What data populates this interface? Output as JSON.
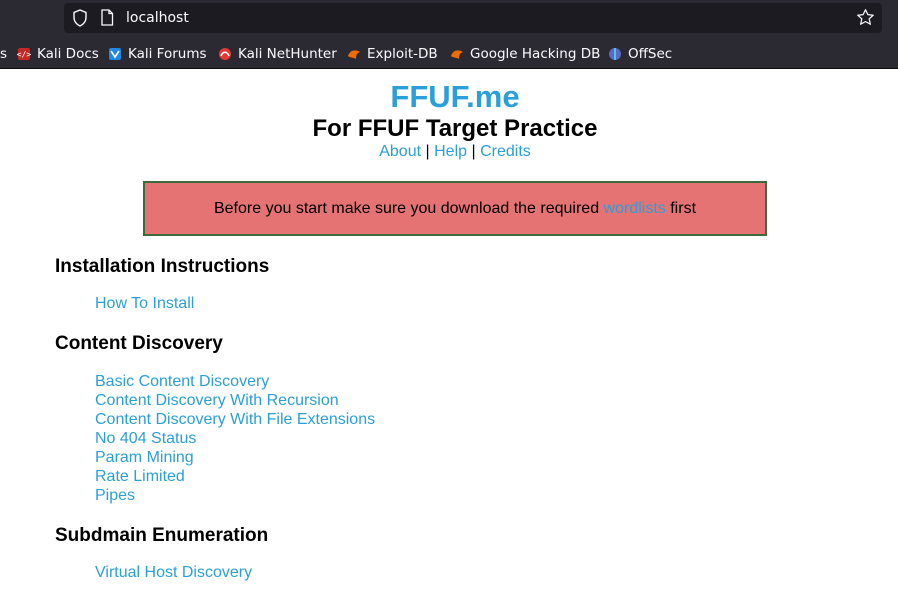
{
  "browser": {
    "url": "localhost",
    "bookmarks": [
      {
        "label": "s",
        "icon": "truncated-bookmark"
      },
      {
        "label": "Kali Docs",
        "icon": "kali-docs-icon"
      },
      {
        "label": "Kali Forums",
        "icon": "kali-forums-icon"
      },
      {
        "label": "Kali NetHunter",
        "icon": "kali-nethunter-icon"
      },
      {
        "label": "Exploit-DB",
        "icon": "exploit-db-icon"
      },
      {
        "label": "Google Hacking DB",
        "icon": "google-hacking-db-icon"
      },
      {
        "label": "OffSec",
        "icon": "offsec-icon"
      }
    ]
  },
  "page": {
    "title": "FFUF.me",
    "subtitle": "For FFUF Target Practice",
    "nav": {
      "about": "About",
      "sep1": "|",
      "help": "Help",
      "sep2": "|",
      "credits": "Credits"
    },
    "notice": {
      "before": "Before you start make sure you download the required",
      "link": "wordlists",
      "after": "first"
    },
    "sections": [
      {
        "title": "Installation Instructions",
        "links": [
          "How To Install"
        ]
      },
      {
        "title": "Content Discovery",
        "links": [
          "Basic Content Discovery",
          "Content Discovery With Recursion",
          "Content Discovery With File Extensions",
          "No 404 Status",
          "Param Mining",
          "Rate Limited",
          "Pipes"
        ]
      },
      {
        "title": "Subdmain Enumeration",
        "links": [
          "Virtual Host Discovery"
        ]
      }
    ]
  },
  "colors": {
    "link": "#2b9fd9",
    "notice_bg": "#e57373",
    "notice_border": "#3c6b3c",
    "chrome_bg": "#2b2a33",
    "urlbar_bg": "#1c1b22"
  }
}
